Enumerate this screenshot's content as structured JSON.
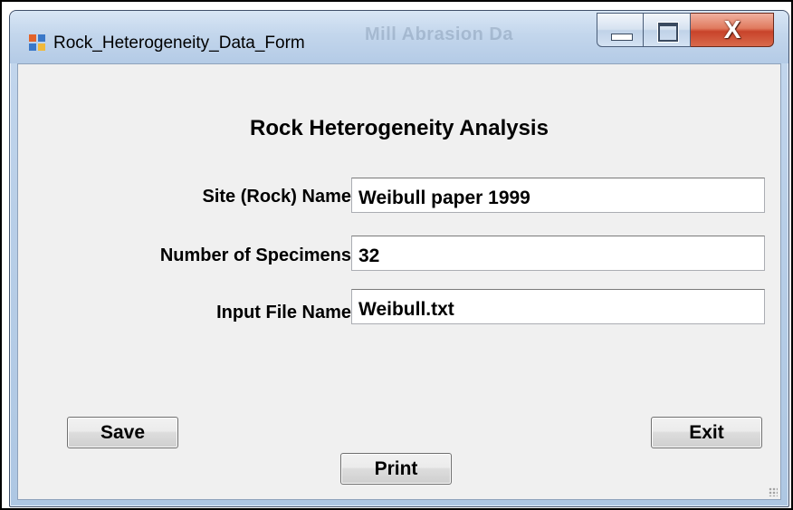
{
  "window": {
    "title": "Rock_Heterogeneity_Data_Form",
    "background_text": "Mill Abrasion Da",
    "icon": "windows-form-icon",
    "controls": {
      "minimize_icon": "minimize-icon",
      "maximize_icon": "maximize-icon",
      "close_icon": "close-icon",
      "close_glyph": "X"
    }
  },
  "form": {
    "heading": "Rock Heterogeneity Analysis",
    "fields": [
      {
        "label": "Site (Rock) Name",
        "value": "Weibull paper 1999"
      },
      {
        "label": "Number of Specimens",
        "value": "32"
      },
      {
        "label": "Input File Name",
        "value": "Weibull.txt"
      }
    ]
  },
  "buttons": {
    "save": "Save",
    "exit": "Exit",
    "print": "Print"
  },
  "colors": {
    "titlebar": "#c3d6ec",
    "client_background": "#f0f0f0",
    "close_button": "#c8432a"
  }
}
